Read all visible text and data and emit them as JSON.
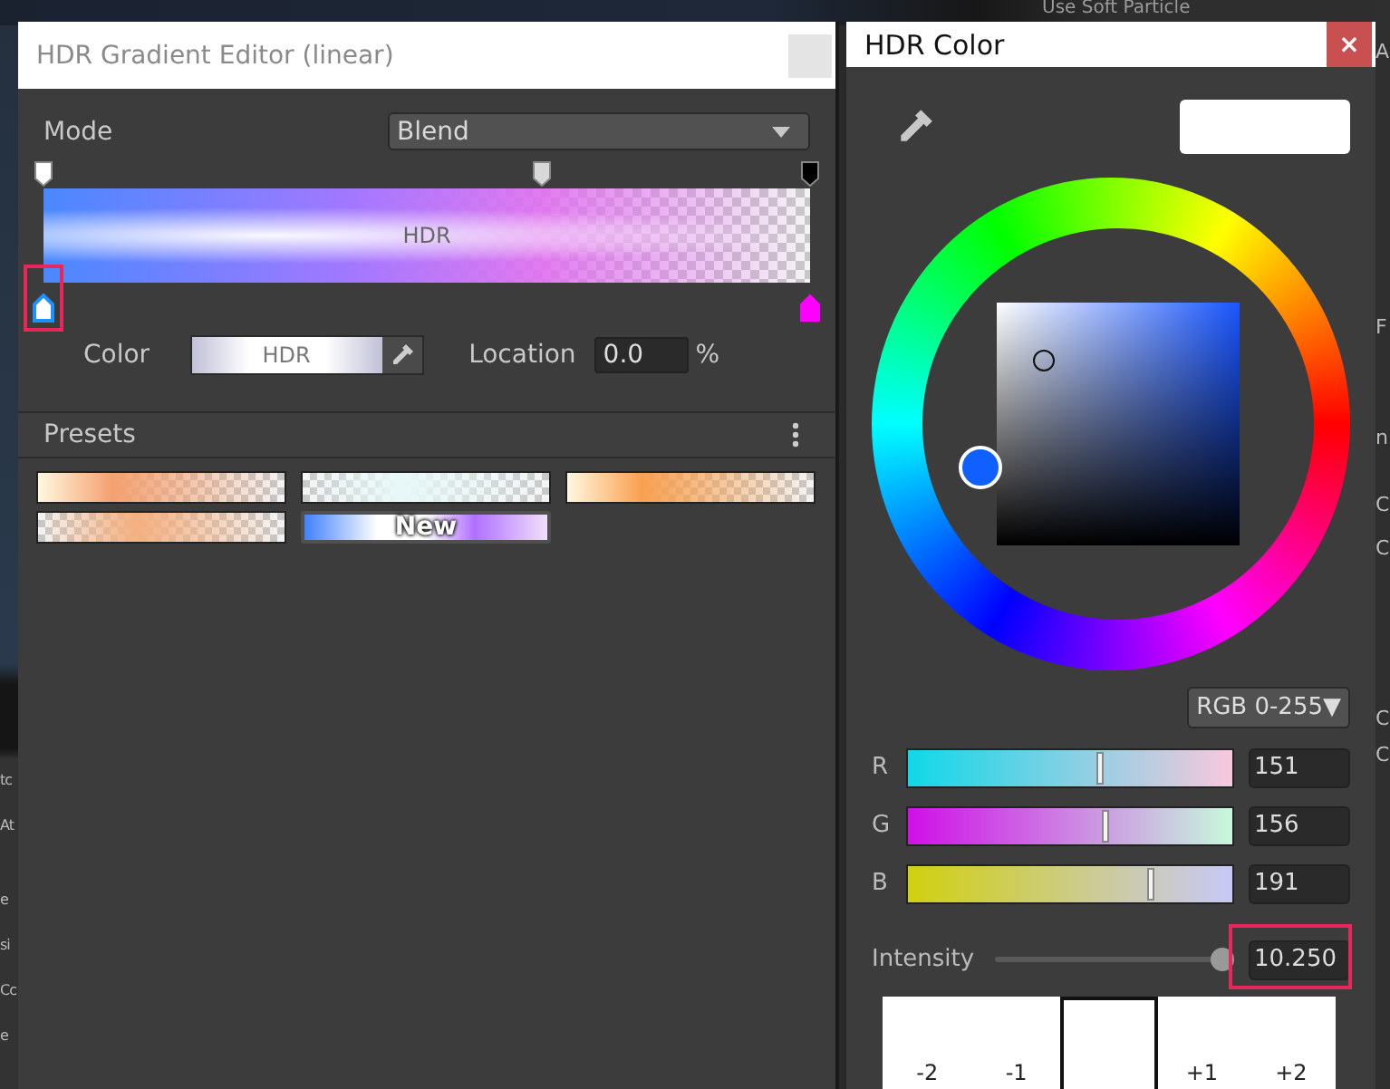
{
  "background": {
    "top_text": "Use Soft Particle",
    "left_fragments": [
      "tc",
      "At",
      "e",
      "si",
      "Cc",
      "e"
    ],
    "right_fragments": [
      "A",
      "F",
      "n",
      "C",
      "C",
      "C",
      "C"
    ]
  },
  "gradient_editor": {
    "title": "HDR Gradient Editor (linear)",
    "mode": {
      "label": "Mode",
      "value": "Blend"
    },
    "alpha_keys": [
      {
        "color": "#ffffff"
      },
      {
        "color": "#d8d8d8"
      },
      {
        "color": "#000000"
      }
    ],
    "bar_label": "HDR",
    "color_keys": [
      {
        "color": "#ffffff",
        "selected": true,
        "highlighted": true
      },
      {
        "color": "#ff00ff",
        "selected": false,
        "highlighted": false
      }
    ],
    "color": {
      "label": "Color",
      "swatch_label": "HDR"
    },
    "location": {
      "label": "Location",
      "value": "0.0",
      "unit": "%"
    },
    "presets": {
      "title": "Presets",
      "items": [
        {
          "color": "#f4a070"
        },
        {
          "color": "#e8f8f8"
        },
        {
          "color": "#f8a050"
        },
        {
          "color": "#f4b080"
        },
        {
          "color": "#b070ff",
          "label": "New"
        }
      ]
    }
  },
  "hdr_color": {
    "title": "HDR Color",
    "close": "×",
    "mode_dropdown": "RGB 0-255▼",
    "channels": [
      {
        "name": "R",
        "level": 0.592,
        "value": "151"
      },
      {
        "name": "G",
        "level": 0.612,
        "value": "156"
      },
      {
        "name": "B",
        "level": 0.749,
        "value": "191"
      }
    ],
    "intensity": {
      "label": "Intensity",
      "level": 0.97,
      "value": "10.250",
      "highlighted": true
    },
    "exposures": [
      {
        "label": "-2",
        "selected": false
      },
      {
        "label": "-1",
        "selected": false
      },
      {
        "selected": true
      },
      {
        "label": "+1",
        "selected": false
      },
      {
        "label": "+2",
        "selected": false
      }
    ]
  }
}
